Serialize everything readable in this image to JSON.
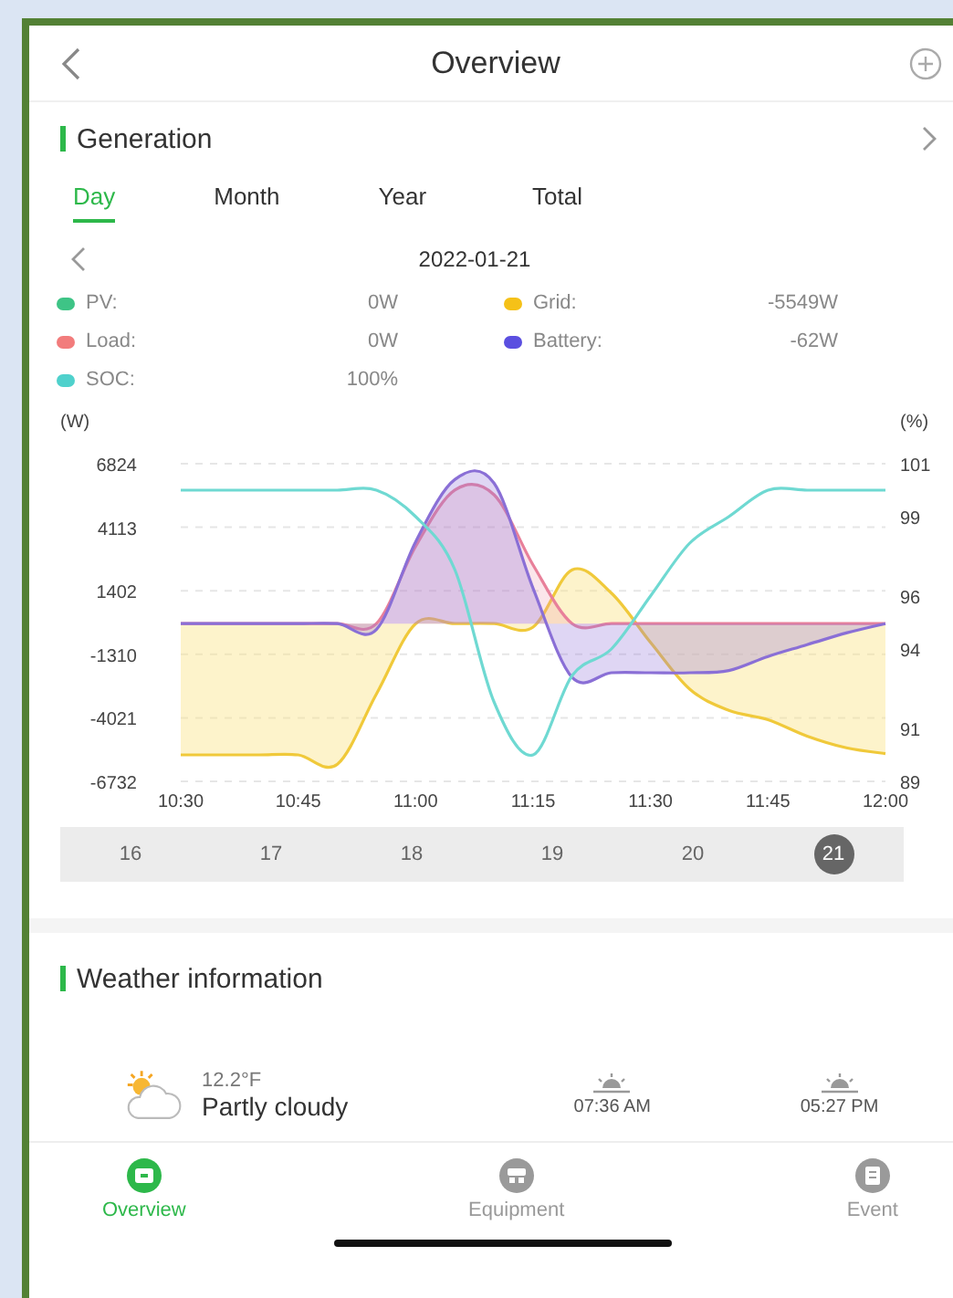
{
  "header": {
    "title": "Overview"
  },
  "generation": {
    "title": "Generation",
    "tabs": [
      {
        "label": "Day",
        "selected": true
      },
      {
        "label": "Month",
        "selected": false
      },
      {
        "label": "Year",
        "selected": false
      },
      {
        "label": "Total",
        "selected": false
      }
    ],
    "date": "2022-01-21",
    "legend": [
      {
        "label": "PV:",
        "value": "0W",
        "color": "#3ec486"
      },
      {
        "label": "Grid:",
        "value": "-5549W",
        "color": "#f5c118"
      },
      {
        "label": "Load:",
        "value": "0W",
        "color": "#f27c7c"
      },
      {
        "label": "Battery:",
        "value": "-62W",
        "color": "#5b4fe0"
      },
      {
        "label": "SOC:",
        "value": "100%",
        "color": "#4fd1cc"
      }
    ],
    "chart_data": {
      "type": "area",
      "ylabel": "(W)",
      "y2label": "(%)",
      "categories": [
        "10:30",
        null,
        null,
        "10:45",
        null,
        null,
        "11:00",
        null,
        null,
        "11:15",
        null,
        null,
        "11:30",
        null,
        null,
        "11:45",
        null,
        null,
        "12:00"
      ],
      "ylim": [
        -6732,
        6824
      ],
      "yticks": [
        6824,
        4113,
        1402,
        -1310,
        -4021,
        -6732
      ],
      "grid": true,
      "y2lim": [
        89,
        101
      ],
      "y2ticks": [
        101,
        99,
        96,
        94,
        91,
        89
      ],
      "series": [
        {
          "color": "#f0c93a",
          "values": [
            -5600,
            -5600,
            -5600,
            -5600,
            -6000,
            -3000,
            0,
            0,
            0,
            -150,
            2300,
            1300,
            -800,
            -2800,
            -3700,
            -4100,
            -4800,
            -5300,
            -5550
          ]
        },
        {
          "color": "#e8809a",
          "values": [
            0,
            0,
            0,
            0,
            0,
            0,
            3300,
            5700,
            5500,
            2500,
            0,
            0,
            0,
            0,
            0,
            0,
            0,
            0,
            0
          ]
        },
        {
          "color": "#8a6fd6",
          "values": [
            0,
            0,
            0,
            0,
            0,
            -250,
            3500,
            6150,
            6000,
            1500,
            -2300,
            -2100,
            -2100,
            -2100,
            -2000,
            -1400,
            -900,
            -400,
            0
          ]
        },
        {
          "color": "#6fd9d2",
          "axis": "y2",
          "type": "line",
          "values": [
            100,
            100,
            100,
            100,
            100,
            100,
            99,
            97,
            92,
            90,
            93,
            94,
            96,
            98,
            99,
            100,
            100,
            100,
            100
          ]
        }
      ]
    },
    "days": [
      {
        "label": "16",
        "selected": false
      },
      {
        "label": "17",
        "selected": false
      },
      {
        "label": "18",
        "selected": false
      },
      {
        "label": "19",
        "selected": false
      },
      {
        "label": "20",
        "selected": false
      },
      {
        "label": "21",
        "selected": true
      }
    ]
  },
  "weather": {
    "title": "Weather information",
    "temperature": "12.2°F",
    "condition": "Partly cloudy",
    "sunrise": "07:36 AM",
    "sunset": "05:27 PM"
  },
  "nav": [
    {
      "kind": "overview",
      "label": "Overview",
      "selected": true
    },
    {
      "kind": "equipment",
      "label": "Equipment",
      "selected": false
    },
    {
      "kind": "event",
      "label": "Event",
      "selected": false
    }
  ]
}
